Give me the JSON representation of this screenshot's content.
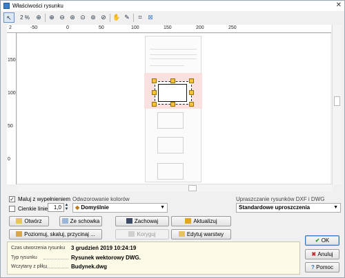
{
  "window": {
    "title": "Właściwości rysunku",
    "close_glyph": "✕"
  },
  "toolbar": {
    "zoom": "2 %",
    "icons": [
      "pointer-icon",
      "zoom-icon",
      "zoom-in-icon",
      "zoom-out-icon",
      "zoom-fit-icon",
      "zoom-page-icon",
      "zoom-window-icon",
      "zoom-sheet-icon",
      "pan-icon",
      "eyedropper-icon",
      "crop-icon",
      "crop-clear-icon"
    ]
  },
  "ruler_top": [
    "-50",
    "0",
    "50",
    "100",
    "150",
    "200",
    "250"
  ],
  "ruler_top_first": "2",
  "ruler_left": [
    "150",
    "100",
    "50",
    "0"
  ],
  "options": {
    "fill_label": "Maluj z wypełnieniem",
    "fill_checked": "✓",
    "thin_lines_label": "Cienkie linie",
    "thin_lines_value": "1,0",
    "color_mapping_label": "Odwzorowanie kolorów",
    "color_mapping_value": "Domyślnie",
    "dxf_label": "Upraszczanie rysunków DXF i DWG",
    "dxf_value": "Standardowe uproszczenia"
  },
  "buttons": {
    "open": "Otwórz",
    "from_clipboard": "Ze schowka",
    "save": "Zachowaj",
    "update": "Aktualizuj",
    "align": "Poziomuj, skaluj, przycinaj ...",
    "correct": "Koryguj",
    "edit_layers": "Edytuj warstwy",
    "ok": "OK",
    "cancel": "Anuluj",
    "help": "Pomoc"
  },
  "info": [
    {
      "key": "Czas utworzenia rysunku",
      "value": "3 grudzień 2019 10:24:19"
    },
    {
      "key": "Typ rysunku",
      "value": "Rysunek wektorowy DWG."
    },
    {
      "key": "Wczytany z pliku",
      "value": "Budynek.dwg"
    }
  ],
  "colors": {
    "accent": "#3b7fc8",
    "selection_band": "#fbe0e0",
    "handle": "#f5c33b",
    "info_bg": "#fdfbe7"
  }
}
